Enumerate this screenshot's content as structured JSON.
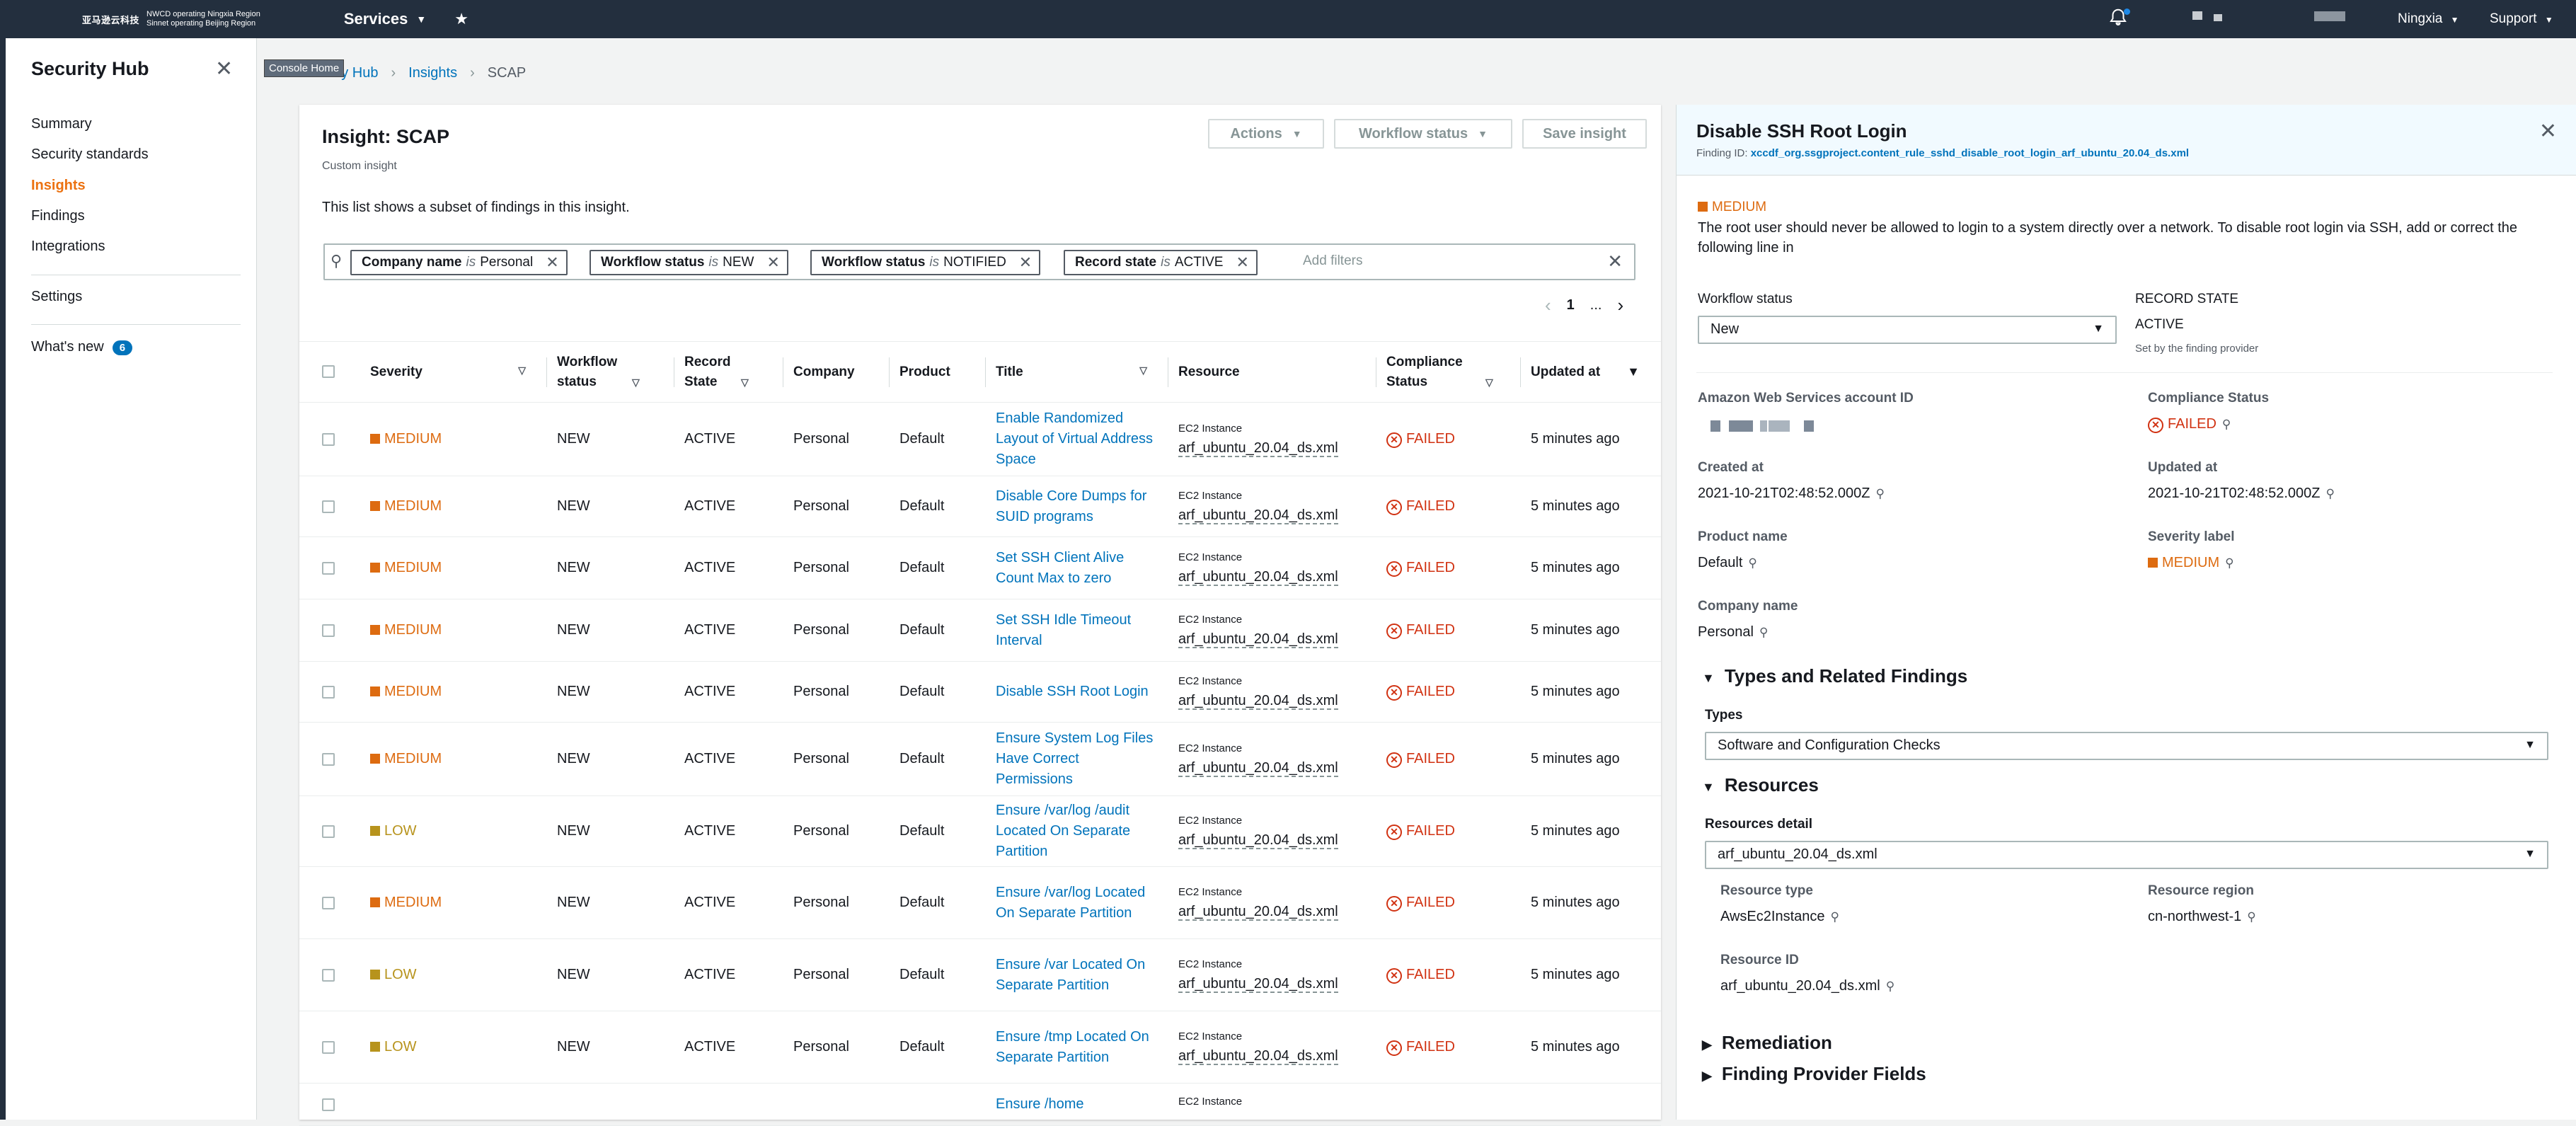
{
  "topnav": {
    "logo_mark": "亚马逊云科技",
    "region_line1": "NWCD operating Ningxia Region",
    "region_line2": "Sinnet operating Beijing Region",
    "services": "Services",
    "region": "Ningxia",
    "support": "Support"
  },
  "sidebar": {
    "title": "Security Hub",
    "items": [
      "Summary",
      "Security standards",
      "Insights",
      "Findings",
      "Integrations",
      "Settings",
      "What's new"
    ],
    "whats_new_count": "6"
  },
  "tooltip": "Console Home",
  "breadcrumb": [
    "Security Hub",
    "Insights",
    "SCAP"
  ],
  "insight": {
    "title": "Insight: SCAP",
    "subtitle": "Custom insight",
    "description": "This list shows a subset of findings in this insight.",
    "actions": "Actions",
    "workflow_status": "Workflow status",
    "save": "Save insight"
  },
  "filters": [
    {
      "key": "Company name",
      "op": "is",
      "value": "Personal"
    },
    {
      "key": "Workflow status",
      "op": "is",
      "value": "NEW"
    },
    {
      "key": "Workflow status",
      "op": "is",
      "value": "NOTIFIED"
    },
    {
      "key": "Record state",
      "op": "is",
      "value": "ACTIVE"
    }
  ],
  "filter_placeholder": "Add filters",
  "pager": {
    "page": "1",
    "more": "..."
  },
  "table": {
    "headers": [
      "Severity",
      "Workflow status",
      "Record State",
      "Company",
      "Product",
      "Title",
      "Resource",
      "Compliance Status",
      "Updated at"
    ],
    "rows": [
      {
        "severity": "MEDIUM",
        "workflow": "NEW",
        "record": "ACTIVE",
        "company": "Personal",
        "product": "Default",
        "title": "Enable Randomized Layout of Virtual Address Space",
        "res_type": "EC2 Instance",
        "resource": "arf_ubuntu_20.04_ds.xml",
        "compliance": "FAILED",
        "updated": "5 minutes ago"
      },
      {
        "severity": "MEDIUM",
        "workflow": "NEW",
        "record": "ACTIVE",
        "company": "Personal",
        "product": "Default",
        "title": "Disable Core Dumps for SUID programs",
        "res_type": "EC2 Instance",
        "resource": "arf_ubuntu_20.04_ds.xml",
        "compliance": "FAILED",
        "updated": "5 minutes ago"
      },
      {
        "severity": "MEDIUM",
        "workflow": "NEW",
        "record": "ACTIVE",
        "company": "Personal",
        "product": "Default",
        "title": "Set SSH Client Alive Count Max to zero",
        "res_type": "EC2 Instance",
        "resource": "arf_ubuntu_20.04_ds.xml",
        "compliance": "FAILED",
        "updated": "5 minutes ago"
      },
      {
        "severity": "MEDIUM",
        "workflow": "NEW",
        "record": "ACTIVE",
        "company": "Personal",
        "product": "Default",
        "title": "Set SSH Idle Timeout Interval",
        "res_type": "EC2 Instance",
        "resource": "arf_ubuntu_20.04_ds.xml",
        "compliance": "FAILED",
        "updated": "5 minutes ago"
      },
      {
        "severity": "MEDIUM",
        "workflow": "NEW",
        "record": "ACTIVE",
        "company": "Personal",
        "product": "Default",
        "title": "Disable SSH Root Login",
        "res_type": "EC2 Instance",
        "resource": "arf_ubuntu_20.04_ds.xml",
        "compliance": "FAILED",
        "updated": "5 minutes ago"
      },
      {
        "severity": "MEDIUM",
        "workflow": "NEW",
        "record": "ACTIVE",
        "company": "Personal",
        "product": "Default",
        "title": "Ensure System Log Files Have Correct Permissions",
        "res_type": "EC2 Instance",
        "resource": "arf_ubuntu_20.04_ds.xml",
        "compliance": "FAILED",
        "updated": "5 minutes ago"
      },
      {
        "severity": "LOW",
        "workflow": "NEW",
        "record": "ACTIVE",
        "company": "Personal",
        "product": "Default",
        "title": "Ensure /var/log /audit Located On Separate Partition",
        "res_type": "EC2 Instance",
        "resource": "arf_ubuntu_20.04_ds.xml",
        "compliance": "FAILED",
        "updated": "5 minutes ago"
      },
      {
        "severity": "MEDIUM",
        "workflow": "NEW",
        "record": "ACTIVE",
        "company": "Personal",
        "product": "Default",
        "title": "Ensure /var/log Located On Separate Partition",
        "res_type": "EC2 Instance",
        "resource": "arf_ubuntu_20.04_ds.xml",
        "compliance": "FAILED",
        "updated": "5 minutes ago"
      },
      {
        "severity": "LOW",
        "workflow": "NEW",
        "record": "ACTIVE",
        "company": "Personal",
        "product": "Default",
        "title": "Ensure /var Located On Separate Partition",
        "res_type": "EC2 Instance",
        "resource": "arf_ubuntu_20.04_ds.xml",
        "compliance": "FAILED",
        "updated": "5 minutes ago"
      },
      {
        "severity": "LOW",
        "workflow": "NEW",
        "record": "ACTIVE",
        "company": "Personal",
        "product": "Default",
        "title": "Ensure /tmp Located On Separate Partition",
        "res_type": "EC2 Instance",
        "resource": "arf_ubuntu_20.04_ds.xml",
        "compliance": "FAILED",
        "updated": "5 minutes ago"
      },
      {
        "severity": "",
        "workflow": "",
        "record": "",
        "company": "",
        "product": "",
        "title": "Ensure /home",
        "res_type": "EC2 Instance",
        "resource": "",
        "compliance": "",
        "updated": ""
      }
    ]
  },
  "detail": {
    "title": "Disable SSH Root Login",
    "finding_id_label": "Finding ID:",
    "finding_id": "xccdf_org.ssgproject.content_rule_sshd_disable_root_login_arf_ubuntu_20.04_ds.xml",
    "severity": "MEDIUM",
    "description": "The root user should never be allowed to login to a system directly over a network. To disable root login via SSH, add or correct the following line in",
    "workflow_label": "Workflow status",
    "workflow_value": "New",
    "record_state_label": "RECORD STATE",
    "record_state_value": "ACTIVE",
    "record_state_note": "Set by the finding provider",
    "account_label": "Amazon Web Services account ID",
    "compliance_label": "Compliance Status",
    "compliance_value": "FAILED",
    "created_label": "Created at",
    "created_value": "2021-10-21T02:48:52.000Z",
    "updated_label": "Updated at",
    "updated_value": "2021-10-21T02:48:52.000Z",
    "product_label": "Product name",
    "product_value": "Default",
    "severity_label": "Severity label",
    "severity_value": "MEDIUM",
    "company_label": "Company name",
    "company_value": "Personal",
    "types_section": "Types and Related Findings",
    "types_label": "Types",
    "types_value": "Software and Configuration Checks",
    "resources_section": "Resources",
    "resources_detail_label": "Resources detail",
    "resources_detail_value": "arf_ubuntu_20.04_ds.xml",
    "resource_type_label": "Resource type",
    "resource_type_value": "AwsEc2Instance",
    "resource_region_label": "Resource region",
    "resource_region_value": "cn-northwest-1",
    "resource_id_label": "Resource ID",
    "resource_id_value": "arf_ubuntu_20.04_ds.xml",
    "remediation_section": "Remediation",
    "provider_section": "Finding Provider Fields"
  },
  "colors": {
    "nav": "#232f3e",
    "medium": "#dd6b10",
    "low": "#b7931c",
    "failed": "#d13212",
    "link": "#0073bb",
    "active": "#ec7211"
  }
}
